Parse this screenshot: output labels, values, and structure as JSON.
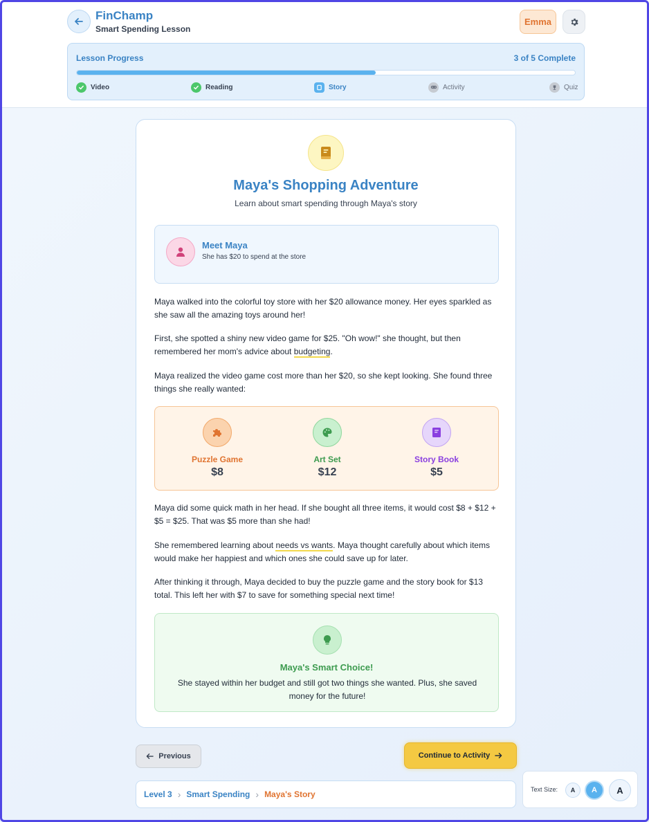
{
  "header": {
    "app_title": "FinChamp",
    "subtitle": "Smart Spending Lesson",
    "user_name": "Emma",
    "back_icon": "arrow-left-icon",
    "settings_icon": "gear-icon"
  },
  "progress": {
    "label": "Lesson Progress",
    "count_text": "3 of 5 Complete",
    "completed": 3,
    "total": 5,
    "fill_fraction": 0.6,
    "steps": [
      {
        "label": "Video",
        "state": "done",
        "icon": "check-icon"
      },
      {
        "label": "Reading",
        "state": "done",
        "icon": "check-icon"
      },
      {
        "label": "Story",
        "state": "current",
        "icon": "book-icon"
      },
      {
        "label": "Activity",
        "state": "todo",
        "icon": "gamepad-icon"
      },
      {
        "label": "Quiz",
        "state": "todo",
        "icon": "trophy-icon"
      }
    ]
  },
  "story": {
    "icon": "book-icon",
    "title": "Maya's Shopping Adventure",
    "subtitle": "Learn about smart spending through Maya's story",
    "meet": {
      "icon": "person-icon",
      "name": "Meet Maya",
      "desc": "She has $20 to spend at the store"
    },
    "p1": "Maya walked into the colorful toy store with her $20 allowance money. Her eyes sparkled as she saw all the amazing toys around her!",
    "p2_before": "First, she spotted a shiny new video game for $25. \"Oh wow!\" she thought, but then remembered her mom's advice about ",
    "p2_highlight": "budgeting",
    "p2_after": ".",
    "p3": "Maya realized the video game cost more than her $20, so she kept looking. She found three things she really wanted:",
    "items": [
      {
        "name": "Puzzle Game",
        "price": "$8",
        "icon": "puzzle-icon",
        "color": "#e07431"
      },
      {
        "name": "Art Set",
        "price": "$12",
        "icon": "palette-icon",
        "color": "#3d9b4f"
      },
      {
        "name": "Story Book",
        "price": "$5",
        "icon": "book-icon",
        "color": "#8a3fe0"
      }
    ],
    "p4": "Maya did some quick math in her head. If she bought all three items, it would cost $8 + $12 + $5 = $25. That was $5 more than she had!",
    "p5_before": "She remembered learning about ",
    "p5_highlight": "needs vs wants",
    "p5_after": ". Maya thought carefully about which items would make her happiest and which ones she could save up for later.",
    "p6": "After thinking it through, Maya decided to buy the puzzle game and the story book for $13 total. This left her with $7 to save for something special next time!",
    "choice": {
      "icon": "lightbulb-icon",
      "title": "Maya's Smart Choice!",
      "text": "She stayed within her budget and still got two things she wanted. Plus, she saved money for the future!"
    }
  },
  "nav": {
    "prev_label": "Previous",
    "next_label": "Continue to Activity"
  },
  "breadcrumb": [
    "Level 3",
    "Smart Spending",
    "Maya's Story"
  ],
  "text_size": {
    "label": "Text Size:",
    "options": [
      "A",
      "A",
      "A"
    ],
    "selected": "medium"
  },
  "colors": {
    "primary": "#3a83c4",
    "accent_orange": "#e07431",
    "accent_yellow": "#f4c942",
    "success": "#4cc76b"
  }
}
